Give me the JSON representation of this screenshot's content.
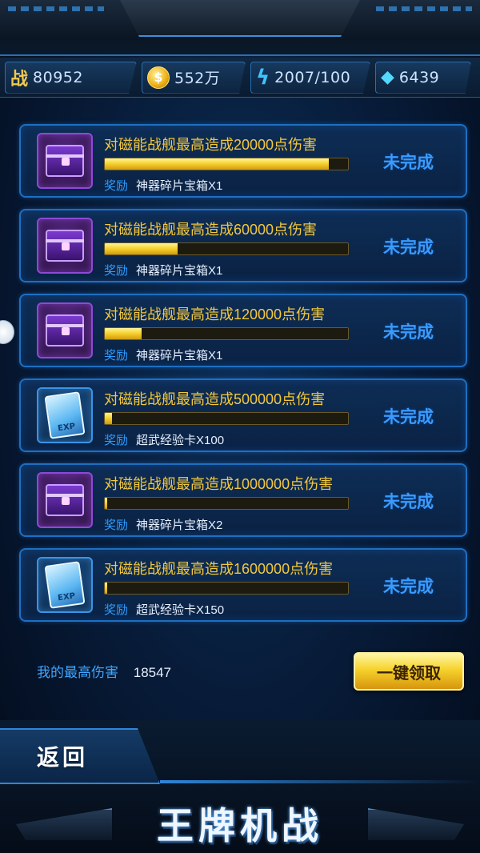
{
  "resources": {
    "power_icon": "战",
    "power": "80952",
    "gold": "552万",
    "energy": "2007/100",
    "gems": "6439"
  },
  "tasks": [
    {
      "title": "对磁能战舰最高造成20000点伤害",
      "progress": 0.92,
      "reward_label": "奖励",
      "reward": "神器碎片宝箱X1",
      "status": "未完成",
      "icon": "purple-chest-icon"
    },
    {
      "title": "对磁能战舰最高造成60000点伤害",
      "progress": 0.3,
      "reward_label": "奖励",
      "reward": "神器碎片宝箱X1",
      "status": "未完成",
      "icon": "purple-chest-icon"
    },
    {
      "title": "对磁能战舰最高造成120000点伤害",
      "progress": 0.15,
      "reward_label": "奖励",
      "reward": "神器碎片宝箱X1",
      "status": "未完成",
      "icon": "purple-chest-icon"
    },
    {
      "title": "对磁能战舰最高造成500000点伤害",
      "progress": 0.03,
      "reward_label": "奖励",
      "reward": "超武经验卡X100",
      "status": "未完成",
      "icon": "exp-card-icon"
    },
    {
      "title": "对磁能战舰最高造成1000000点伤害",
      "progress": 0.01,
      "reward_label": "奖励",
      "reward": "神器碎片宝箱X2",
      "status": "未完成",
      "icon": "purple-chest-icon"
    },
    {
      "title": "对磁能战舰最高造成1600000点伤害",
      "progress": 0.01,
      "reward_label": "奖励",
      "reward": "超武经验卡X150",
      "status": "未完成",
      "icon": "exp-card-icon"
    }
  ],
  "footer": {
    "max_damage_label": "我的最高伤害",
    "max_damage_value": "18547",
    "claim_all": "一键领取",
    "back": "返回",
    "logo": "王牌机战"
  },
  "colors": {
    "accent_blue": "#3a9bff",
    "title_gold": "#f3c83b",
    "bar_fill": "#f7d330"
  }
}
